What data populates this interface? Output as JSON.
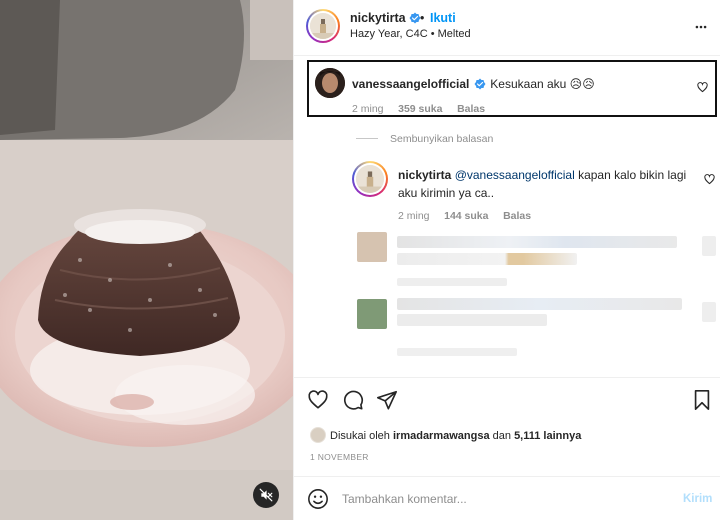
{
  "post": {
    "author": "nickytirta",
    "follow_label": "Ikuti",
    "dot": "•",
    "audio": "Hazy Year, C4C • Melted",
    "more_icon": "more-horizontal-icon"
  },
  "comments": [
    {
      "username": "vanessaangelofficial",
      "text": "Kesukaan aku 😥😥",
      "time": "2 ming",
      "likes": "359 suka",
      "reply_label": "Balas"
    }
  ],
  "hide_replies_label": "Sembunyikan balasan",
  "reply": {
    "username": "nickytirta",
    "mention": "@vanessaangelofficial",
    "text": " kapan kalo bikin lagi aku kirimin ya ca..",
    "time": "2 ming",
    "likes": "144 suka",
    "reply_label": "Balas"
  },
  "actions": {
    "like_icon": "heart-icon",
    "comment_icon": "comment-icon",
    "share_icon": "send-icon",
    "save_icon": "bookmark-icon"
  },
  "likes": {
    "prefix": "Disukai oleh ",
    "user": "irmadarmawangsa",
    "middle": " dan ",
    "count": "5,111 lainnya"
  },
  "date": "1 NOVEMBER",
  "composer": {
    "placeholder": "Tambahkan komentar...",
    "post_label": "Kirim"
  },
  "colors": {
    "accent": "#0095f6",
    "verified": "#3897f0",
    "link": "#00376b"
  }
}
